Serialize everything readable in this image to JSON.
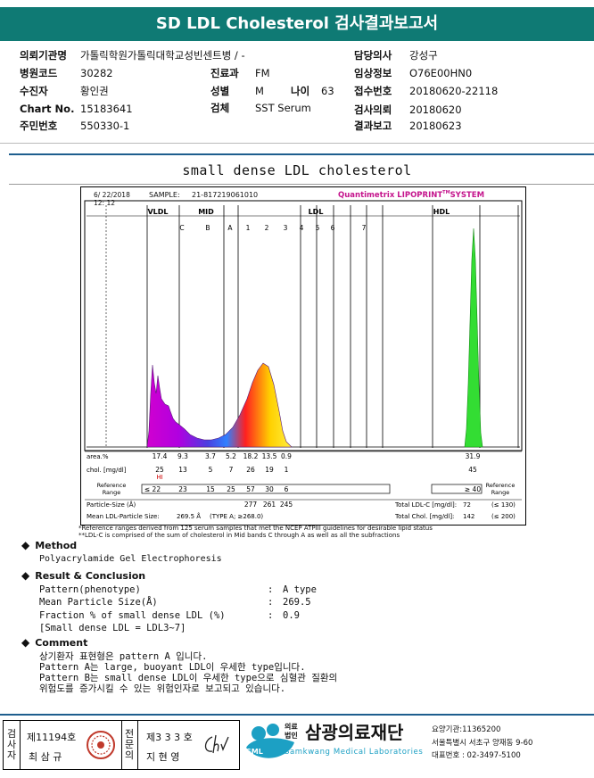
{
  "header": {
    "title": "SD LDL Cholesterol 검사결과보고서"
  },
  "info": {
    "hospital_label": "의뢰기관명",
    "hospital": "가톨릭학원가톨릭대학교성빈센트병 / -",
    "doctor_label": "담당의사",
    "doctor": "강성구",
    "code_label": "병원코드",
    "code": "30282",
    "dept_label": "진료과",
    "dept": "FM",
    "clinical_label": "임상정보",
    "clinical": "O76E00HN0",
    "patient_label": "수진자",
    "patient": "황인권",
    "sex_label": "성별",
    "sex": "M",
    "age_label": "나이",
    "age": "63",
    "receipt_label": "접수번호",
    "receipt": "20180620-22118",
    "chart_label": "Chart No.",
    "chart": "15183641",
    "specimen_label": "검체",
    "specimen": "SST Serum",
    "request_label": "검사의뢰",
    "request": "20180620",
    "id_label": "주민번호",
    "id": "550330-1",
    "report_label": "결과보고",
    "report": "20180623"
  },
  "report_title": "small dense LDL cholesterol",
  "chart_data": {
    "type": "area",
    "date": "6/ 22/2018",
    "time": "12: 12",
    "sample_label": "SAMPLE:",
    "sample_id": "21-817219061010",
    "system": "Quantimetrix LIPOPRINT",
    "system_tm": "TM",
    "system_suffix": "SYSTEM",
    "groups": [
      "VLDL",
      "MID",
      "LDL",
      "HDL"
    ],
    "bands": [
      "C",
      "B",
      "A",
      "1",
      "2",
      "3",
      "4",
      "5",
      "6",
      "7"
    ],
    "area_label": "area.%",
    "area_values": [
      "17.4",
      "9.3",
      "3.7",
      "5.2",
      "18.2",
      "13.5",
      "0.9",
      "31.9"
    ],
    "chol_label": "chol. [mg/dl]",
    "chol_values": [
      "25",
      "13",
      "5",
      "7",
      "26",
      "19",
      "1",
      "45"
    ],
    "chol_flag": "HI",
    "ref_label_1": "Reference",
    "ref_label_2": "Range",
    "ref_values": [
      "≤ 22",
      "23",
      "15",
      "25",
      "57",
      "30",
      "6",
      "≥ 40"
    ],
    "particle_label": "Particle-Size (Å)",
    "particle_values": [
      "277",
      "261",
      "245"
    ],
    "mean_label": "Mean LDL-Particle Size:",
    "mean_value": "269.5 Å",
    "mean_type": "(TYPE A; ≥268.0)",
    "total_ldl_label": "Total LDL-C [mg/dl]:",
    "total_ldl": "72",
    "total_ldl_ref": "(≤ 130)",
    "total_chol_label": "Total Chol. [mg/dl]:",
    "total_chol": "142",
    "total_chol_ref": "(≤ 200)"
  },
  "notes": {
    "n1": "*Reference ranges derived from 125 serum samples that met the NCEP ATPIII guidelines for desirable lipid status",
    "n2": "**LDL-C is comprised of the sum of cholesterol in Mid bands C through A as well as all the subfractions"
  },
  "method": {
    "title": "Method",
    "text": "Polyacrylamide Gel Electrophoresis"
  },
  "result": {
    "title": "Result & Conclusion",
    "pattern_label": "Pattern(phenotype)",
    "pattern": "A type",
    "mps_label": "Mean Particle Size(Å)",
    "mps": "269.5",
    "frac_label": "Fraction % of small dense LDL (%)",
    "frac": "0.9",
    "sd_def": "[Small dense LDL = LDL3~7]",
    "colon": ":"
  },
  "comment": {
    "title": "Comment",
    "l1": "상기환자 표현형은 pattern A 입니다.",
    "l2": "Pattern A는 large, buoyant LDL이 우세한 type입니다.",
    "l3": "Pattern B는 small dense LDL이 우세한 type으로 심혈관 질환의",
    "l4": "위험도를 증가시킬 수 있는 위험인자로 보고되고 있습니다."
  },
  "footer": {
    "col1": [
      "검",
      "사",
      "자"
    ],
    "tester_no": "제11194호",
    "tester_name": "최 삼 규",
    "col2": [
      "전",
      "문",
      "의"
    ],
    "spec_no": "제3 3 3 호",
    "spec_name": "지 현 영",
    "sml": "SML",
    "org_prefix_1": "의료",
    "org_prefix_2": "법인",
    "org_name": "삼광의료재단",
    "org_en": "Samkwang Medical Laboratories",
    "code_line": "요양기관:11365200",
    "addr_line": "서울특별시 서초구 양재동 9-60",
    "tel_line": "대표번호 : 02-3497-5100"
  },
  "colors": {
    "header": "#0f7a74",
    "rule": "#1e5e8e",
    "system": "#c4148c"
  }
}
